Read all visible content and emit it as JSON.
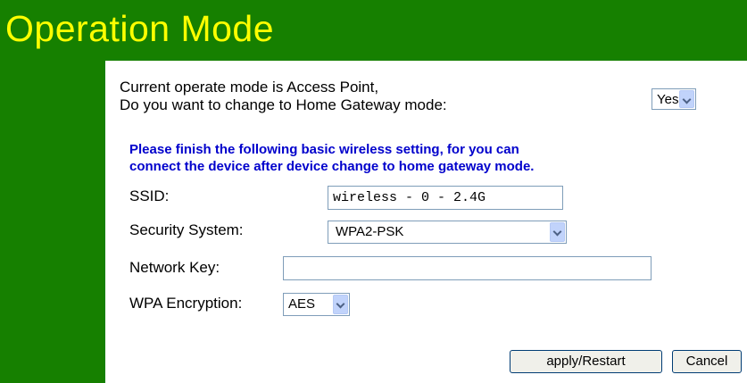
{
  "header": {
    "title": "Operation Mode"
  },
  "mode": {
    "line1": "Current operate mode is Access Point,",
    "line2": "Do you want to change to Home Gateway mode:",
    "select_value": "Yes"
  },
  "note": {
    "line1": "Please finish the following basic wireless setting, for you can",
    "line2": "connect the device after device change to home gateway mode."
  },
  "form": {
    "ssid_label": "SSID:",
    "ssid_value": "wireless - 0 - 2.4G",
    "security_label": "Security System:",
    "security_value": "WPA2-PSK",
    "network_key_label": "Network Key:",
    "network_key_value": "",
    "wpa_label": "WPA Encryption:",
    "wpa_value": "AES"
  },
  "buttons": {
    "apply": "apply/Restart",
    "cancel": "Cancel"
  },
  "colors": {
    "header_bg": "#168000",
    "title": "#ffff00",
    "note": "#0000cc"
  }
}
